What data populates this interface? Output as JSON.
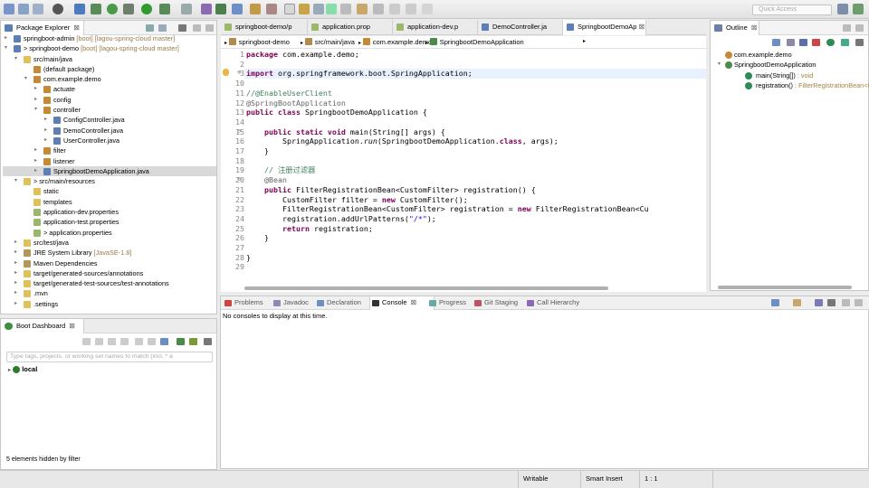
{
  "toolbar": {
    "quick_access_placeholder": "Quick Access"
  },
  "package_explorer": {
    "title": "Package Explorer",
    "rows": [
      {
        "level": 0,
        "label": "springboot-admin",
        "suffix": " [boot] [lagou-spring-cloud master]",
        "icon": "project",
        "twisty": "▸"
      },
      {
        "level": 0,
        "label": "> springboot-demo",
        "suffix": " [boot] [lagou-spring-cloud master]",
        "icon": "project",
        "twisty": "▾"
      },
      {
        "level": 1,
        "label": "src/main/java",
        "suffix": "",
        "icon": "folder",
        "twisty": "▾"
      },
      {
        "level": 2,
        "label": "(default package)",
        "suffix": "",
        "icon": "package",
        "twisty": ""
      },
      {
        "level": 2,
        "label": "com.example.demo",
        "suffix": "",
        "icon": "package",
        "twisty": "▾"
      },
      {
        "level": 3,
        "label": "actuate",
        "suffix": "",
        "icon": "package",
        "twisty": "▸"
      },
      {
        "level": 3,
        "label": "config",
        "suffix": "",
        "icon": "package",
        "twisty": "▸"
      },
      {
        "level": 3,
        "label": "controller",
        "suffix": "",
        "icon": "package",
        "twisty": "▾"
      },
      {
        "level": 4,
        "label": "ConfigController.java",
        "suffix": "",
        "icon": "java",
        "twisty": "▸"
      },
      {
        "level": 4,
        "label": "DemoController.java",
        "suffix": "",
        "icon": "java",
        "twisty": "▸"
      },
      {
        "level": 4,
        "label": "UserController.java",
        "suffix": "",
        "icon": "java",
        "twisty": "▸"
      },
      {
        "level": 3,
        "label": "filter",
        "suffix": "",
        "icon": "package",
        "twisty": "▸"
      },
      {
        "level": 3,
        "label": "listener",
        "suffix": "",
        "icon": "package",
        "twisty": "▸"
      },
      {
        "level": 3,
        "label": "SpringbootDemoApplication.java",
        "suffix": "",
        "icon": "java",
        "twisty": "▸",
        "selected": true
      },
      {
        "level": 1,
        "label": "> src/main/resources",
        "suffix": "",
        "icon": "folder",
        "twisty": "▾"
      },
      {
        "level": 2,
        "label": "static",
        "suffix": "",
        "icon": "fold",
        "twisty": ""
      },
      {
        "level": 2,
        "label": "templates",
        "suffix": "",
        "icon": "fold",
        "twisty": ""
      },
      {
        "level": 2,
        "label": "application-dev.properties",
        "suffix": "",
        "icon": "prop",
        "twisty": ""
      },
      {
        "level": 2,
        "label": "application-test.properties",
        "suffix": "",
        "icon": "prop",
        "twisty": ""
      },
      {
        "level": 2,
        "label": "> application.properties",
        "suffix": "",
        "icon": "prop",
        "twisty": ""
      },
      {
        "level": 1,
        "label": "src/test/java",
        "suffix": "",
        "icon": "folder",
        "twisty": "▸"
      },
      {
        "level": 1,
        "label": "JRE System Library",
        "suffix": " [JavaSE-1.8]",
        "icon": "jar",
        "twisty": "▸"
      },
      {
        "level": 1,
        "label": "Maven Dependencies",
        "suffix": "",
        "icon": "jar",
        "twisty": "▸"
      },
      {
        "level": 1,
        "label": "target/generated-sources/annotations",
        "suffix": "",
        "icon": "folder",
        "twisty": "▸"
      },
      {
        "level": 1,
        "label": "target/generated-test-sources/test-annotations",
        "suffix": "",
        "icon": "folder",
        "twisty": "▸"
      },
      {
        "level": 1,
        "label": ".mvn",
        "suffix": "",
        "icon": "fold",
        "twisty": "▸"
      },
      {
        "level": 1,
        "label": ".settings",
        "suffix": "",
        "icon": "fold",
        "twisty": "▸"
      }
    ]
  },
  "boot_dashboard": {
    "title": "Boot Dashboard",
    "filter_placeholder": "Type tags, projects, or working set names to match (incl. * a",
    "root_label": "local",
    "hidden_note": "5 elements hidden by filter"
  },
  "editor": {
    "tabs": [
      {
        "label": "springboot-demo/p",
        "icon": "prop"
      },
      {
        "label": "application.prop",
        "icon": "prop"
      },
      {
        "label": "application-dev.p",
        "icon": "prop"
      },
      {
        "label": "DemoController.ja",
        "icon": "java"
      },
      {
        "label": "SpringbootDemoAp",
        "icon": "java",
        "active": true
      }
    ],
    "breadcrumb": [
      "springboot-demo",
      "src/main/java",
      "com.example.demo",
      "SpringbootDemoApplication"
    ],
    "lines": [
      {
        "n": "1",
        "marker": "",
        "html": "<span class='kw'>package</span> com.example.demo;"
      },
      {
        "n": "2",
        "marker": "",
        "html": ""
      },
      {
        "n": "3",
        "marker": "⊕",
        "html": "<span class='kw'>import</span> org.springframework.boot.SpringApplication;"
      },
      {
        "n": "10",
        "marker": "",
        "html": ""
      },
      {
        "n": "11",
        "marker": "",
        "html": "<span class='cm'>//@EnableUserClient</span>"
      },
      {
        "n": "12",
        "marker": "",
        "html": "<span class='an'>@SpringBootApplication</span>"
      },
      {
        "n": "13",
        "marker": "",
        "html": "<span class='kw'>public class</span> SpringbootDemoApplication {"
      },
      {
        "n": "14",
        "marker": "",
        "html": ""
      },
      {
        "n": "15",
        "marker": "⊖",
        "html": "    <span class='kw'>public static void</span> main(String[] args) {"
      },
      {
        "n": "16",
        "marker": "",
        "html": "        SpringApplication.<i>run</i>(SpringbootDemoApplication.<span class='kw'>class</span>, args);"
      },
      {
        "n": "17",
        "marker": "",
        "html": "    }"
      },
      {
        "n": "18",
        "marker": "",
        "html": ""
      },
      {
        "n": "19",
        "marker": "",
        "html": "    <span class='cm'>// 注册过滤器</span>"
      },
      {
        "n": "20",
        "marker": "⊖",
        "html": "    <span class='an'>@Bean</span>"
      },
      {
        "n": "21",
        "marker": "",
        "html": "    <span class='kw'>public</span> FilterRegistrationBean&lt;CustomFilter&gt; registration() {"
      },
      {
        "n": "22",
        "marker": "",
        "html": "        CustomFilter filter = <span class='kw'>new</span> CustomFilter();"
      },
      {
        "n": "23",
        "marker": "",
        "html": "        FilterRegistrationBean&lt;CustomFilter&gt; registration = <span class='kw'>new</span> FilterRegistrationBean&lt;Cu"
      },
      {
        "n": "24",
        "marker": "",
        "html": "        registration.addUrlPatterns(<span class='st'>\"/*\"</span>);"
      },
      {
        "n": "25",
        "marker": "",
        "html": "        <span class='kw'>return</span> registration;"
      },
      {
        "n": "26",
        "marker": "",
        "html": "    }"
      },
      {
        "n": "27",
        "marker": "",
        "html": ""
      },
      {
        "n": "28",
        "marker": "",
        "html": "}"
      },
      {
        "n": "29",
        "marker": "",
        "html": ""
      }
    ]
  },
  "outline": {
    "title": "Outline",
    "rows": [
      {
        "level": 0,
        "label": "com.example.demo",
        "type": ""
      },
      {
        "level": 0,
        "label": "SpringbootDemoApplication",
        "type": ""
      },
      {
        "level": 1,
        "label": "main(String[])",
        "type": " : void"
      },
      {
        "level": 1,
        "label": "registration()",
        "type": " : FilterRegistrationBean<Cu"
      }
    ]
  },
  "console": {
    "tabs": [
      "Problems",
      "Javadoc",
      "Declaration",
      "Console",
      "Progress",
      "Git Staging",
      "Call Hierarchy"
    ],
    "active": "Console",
    "message": "No consoles to display at this time."
  },
  "status": {
    "writable": "Writable",
    "insert_mode": "Smart Insert",
    "position": "1 : 1"
  }
}
